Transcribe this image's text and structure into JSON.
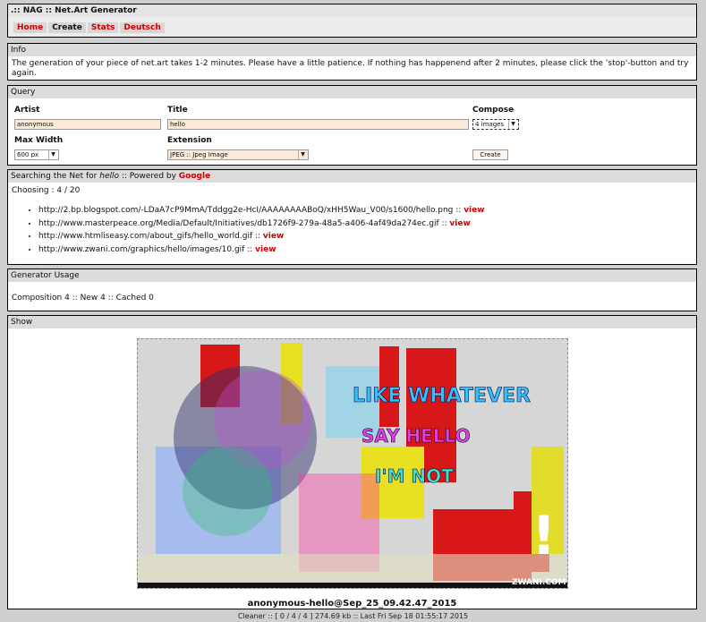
{
  "header": {
    "title": ".:: NAG :: Net.Art Generator",
    "nav": [
      {
        "label": "Home",
        "color": "#cc0000"
      },
      {
        "label": "Create",
        "color": "#111111"
      },
      {
        "label": "Stats",
        "color": "#cc0000"
      },
      {
        "label": "Deutsch",
        "color": "#cc0000"
      }
    ]
  },
  "info": {
    "heading": "Info",
    "text": "The generation of your piece of net.art takes 1-2 minutes. Please have a little patience. If nothing has happenend after 2 minutes, please click the 'stop'-button and try again."
  },
  "query": {
    "heading": "Query",
    "artist_label": "Artist",
    "artist_value": "anonymous",
    "title_label": "Title",
    "title_value": "hello",
    "compose_label": "Compose",
    "compose_value": "4 images",
    "maxwidth_label": "Max Width",
    "maxwidth_value": "600 px",
    "extension_label": "Extension",
    "extension_value": "JPEG :: Jpeg Image",
    "create_button": "Create"
  },
  "search": {
    "heading_prefix": "Searching the Net for ",
    "heading_term": "hello",
    "heading_mid": " :: Powered by ",
    "heading_engine": "Google",
    "choosing": "Choosing : 4 / 20",
    "results": [
      {
        "url": "http://2.bp.blogspot.com/-LDaA7cP9MmA/Tddgg2e-HcI/AAAAAAAABoQ/xHH5Wau_V00/s1600/hello.png",
        "sep": " :: ",
        "view": "view"
      },
      {
        "url": "http://www.masterpeace.org/Media/Default/Initiatives/db1726f9-279a-48a5-a406-4af49da274ec.gif",
        "sep": " :: ",
        "view": "view"
      },
      {
        "url": "http://www.htmliseasy.com/about_gifs/hello_world.gif",
        "sep": " :: ",
        "view": "view"
      },
      {
        "url": "http://www.zwani.com/graphics/hello/images/10.gif",
        "sep": " :: ",
        "view": "view"
      }
    ]
  },
  "usage": {
    "heading": "Generator Usage",
    "text": "Composition 4 :: New 4 :: Cached 0"
  },
  "show": {
    "heading": "Show",
    "caption": "anonymous-hello@Sep_25_09.42.47_2015",
    "watermark": "ZWANI.COM"
  },
  "footer": {
    "text": "Cleaner :: [ 0 / 4 / 4 ] 274.69 kb :: Last Fri Sep 18 01:55:17 2015"
  }
}
